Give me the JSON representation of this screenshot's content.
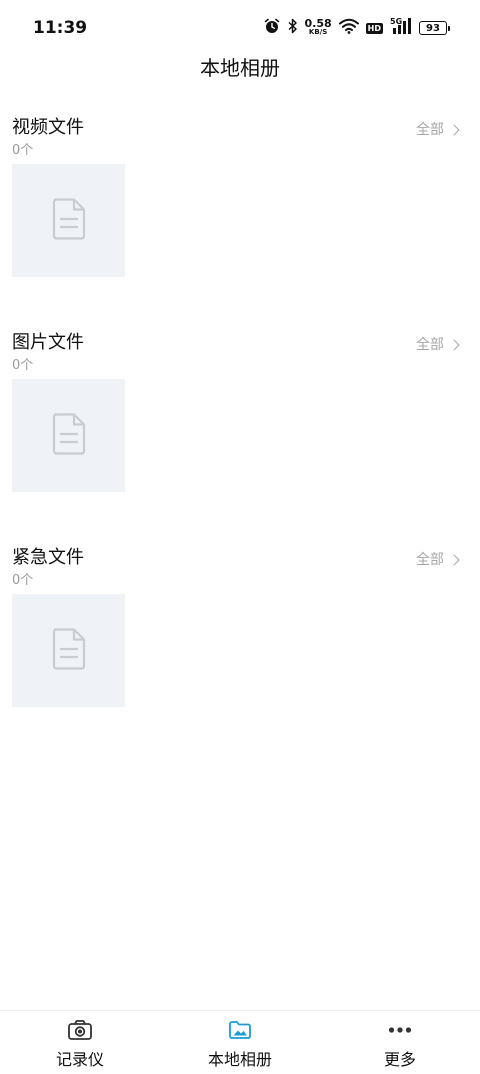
{
  "status_bar": {
    "time": "11:39",
    "net_speed_value": "0.58",
    "net_speed_unit": "KB/S",
    "hd_badge": "HD",
    "network_type": "5G",
    "battery": "93"
  },
  "header": {
    "title": "本地相册"
  },
  "sections": [
    {
      "title": "视频文件",
      "count": "0个",
      "see_all": "全部"
    },
    {
      "title": "图片文件",
      "count": "0个",
      "see_all": "全部"
    },
    {
      "title": "紧急文件",
      "count": "0个",
      "see_all": "全部"
    }
  ],
  "bottom_nav": {
    "items": [
      {
        "label": "记录仪",
        "icon": "camera-icon",
        "active": false
      },
      {
        "label": "本地相册",
        "icon": "folder-image-icon",
        "active": true
      },
      {
        "label": "更多",
        "icon": "more-dots-icon",
        "active": false
      }
    ],
    "active_color": "#1a9bd7",
    "inactive_color": "#333333"
  },
  "colors": {
    "placeholder_bg": "#eff2f7",
    "placeholder_icon": "#c9ccd1",
    "muted_text": "#9a9a9a"
  }
}
